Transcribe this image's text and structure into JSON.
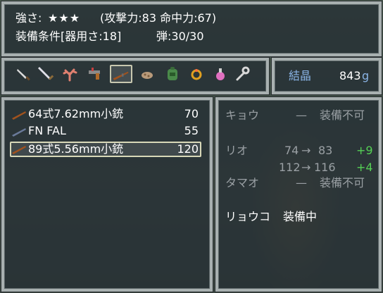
{
  "info": {
    "line1_strength_label": "強さ:",
    "line1_stars": "★★★",
    "line1_stats": "(攻撃力:83 命中力:67)",
    "line2_requirement": "装備条件[器用さ:18]",
    "line2_ammo": "弾:30/30"
  },
  "item_categories": [
    {
      "icon": "knife-icon"
    },
    {
      "icon": "sword-icon"
    },
    {
      "icon": "coral-icon"
    },
    {
      "icon": "pistol-icon"
    },
    {
      "icon": "rifle-icon",
      "selected": true
    },
    {
      "icon": "ore-icon"
    },
    {
      "icon": "pack-icon"
    },
    {
      "icon": "ring-icon"
    },
    {
      "icon": "potion-icon"
    },
    {
      "icon": "wrench-icon"
    }
  ],
  "currency": {
    "label": "結晶",
    "amount": "843",
    "unit": "g"
  },
  "weapons": [
    {
      "name": "64式7.62mm小銃",
      "value": "70",
      "icon": "rifle-icon",
      "selected": false
    },
    {
      "name": "FN FAL",
      "value": "55",
      "icon": "rifle-icon",
      "selected": false
    },
    {
      "name": "89式5.56mm小銃",
      "value": "120",
      "icon": "rifle-icon",
      "selected": true
    }
  ],
  "party": {
    "kyou": {
      "name": "キョウ",
      "dash": "—",
      "status": "装備不可"
    },
    "rio": {
      "name": "リオ",
      "atk_from": "74",
      "atk_to": "83",
      "atk_diff": "+9",
      "hit_from": "112",
      "hit_to": "116",
      "hit_diff": "+4",
      "arrow": "→"
    },
    "tamao": {
      "name": "タマオ",
      "dash": "—",
      "status": "装備不可"
    },
    "ryouko": {
      "name": "リョウコ",
      "status": "装備中"
    }
  },
  "colors": {
    "accent_blue": "#8ab4e6",
    "positive_green": "#55d055",
    "dimmed_text": "#9aa0a4",
    "window_border": "#a8b0b0"
  }
}
